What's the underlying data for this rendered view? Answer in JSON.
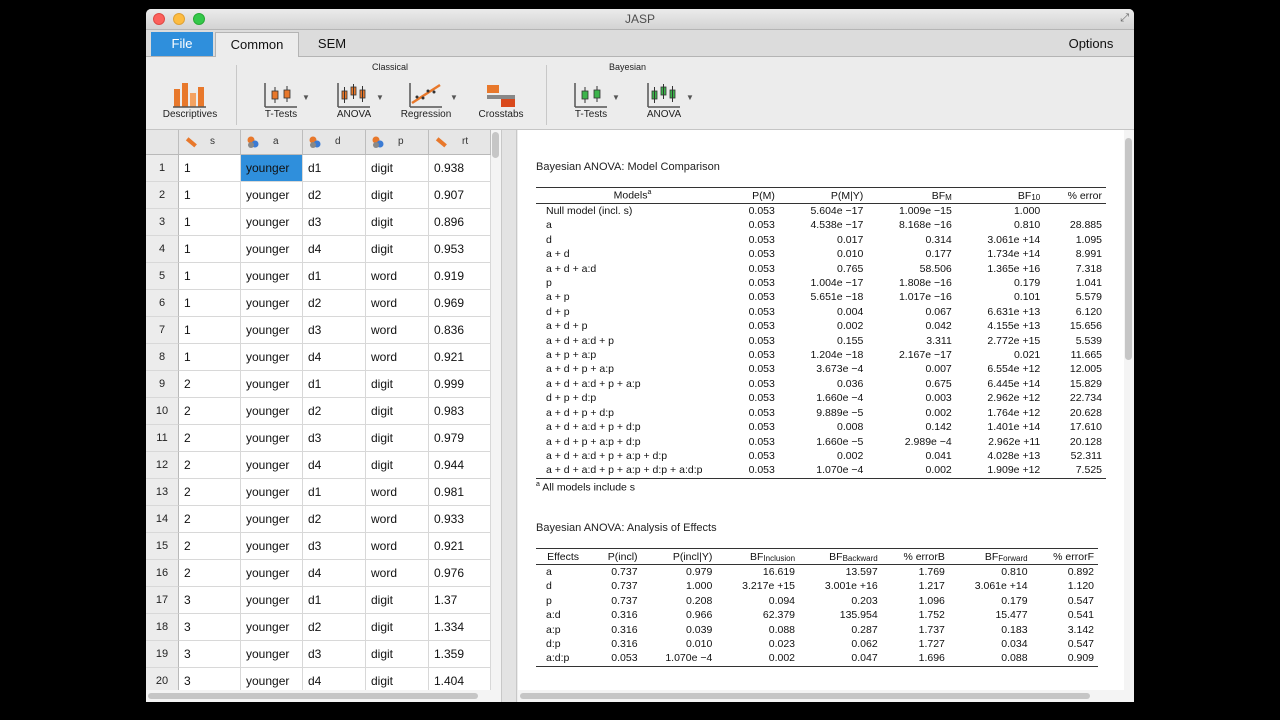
{
  "window": {
    "title": "JASP"
  },
  "tabs": {
    "file": "File",
    "common": "Common",
    "sem": "SEM",
    "options": "Options"
  },
  "ribbon": {
    "classical_label": "Classical",
    "bayesian_label": "Bayesian",
    "descriptives": "Descriptives",
    "t_tests": "T-Tests",
    "anova": "ANOVA",
    "regression": "Regression",
    "crosstabs": "Crosstabs",
    "b_t_tests": "T-Tests",
    "b_anova": "ANOVA"
  },
  "grid": {
    "columns": [
      "s",
      "a",
      "d",
      "p",
      "rt"
    ],
    "rows": [
      [
        "1",
        "younger",
        "d1",
        "digit",
        "0.938"
      ],
      [
        "1",
        "younger",
        "d2",
        "digit",
        "0.907"
      ],
      [
        "1",
        "younger",
        "d3",
        "digit",
        "0.896"
      ],
      [
        "1",
        "younger",
        "d4",
        "digit",
        "0.953"
      ],
      [
        "1",
        "younger",
        "d1",
        "word",
        "0.919"
      ],
      [
        "1",
        "younger",
        "d2",
        "word",
        "0.969"
      ],
      [
        "1",
        "younger",
        "d3",
        "word",
        "0.836"
      ],
      [
        "1",
        "younger",
        "d4",
        "word",
        "0.921"
      ],
      [
        "2",
        "younger",
        "d1",
        "digit",
        "0.999"
      ],
      [
        "2",
        "younger",
        "d2",
        "digit",
        "0.983"
      ],
      [
        "2",
        "younger",
        "d3",
        "digit",
        "0.979"
      ],
      [
        "2",
        "younger",
        "d4",
        "digit",
        "0.944"
      ],
      [
        "2",
        "younger",
        "d1",
        "word",
        "0.981"
      ],
      [
        "2",
        "younger",
        "d2",
        "word",
        "0.933"
      ],
      [
        "2",
        "younger",
        "d3",
        "word",
        "0.921"
      ],
      [
        "2",
        "younger",
        "d4",
        "word",
        "0.976"
      ],
      [
        "3",
        "younger",
        "d1",
        "digit",
        "1.37"
      ],
      [
        "3",
        "younger",
        "d2",
        "digit",
        "1.334"
      ],
      [
        "3",
        "younger",
        "d3",
        "digit",
        "1.359"
      ],
      [
        "3",
        "younger",
        "d4",
        "digit",
        "1.404"
      ]
    ]
  },
  "model_comparison": {
    "title": "Bayesian ANOVA: Model Comparison",
    "headers": [
      "Models",
      "P(M)",
      "P(M|Y)",
      "BF",
      "BF",
      "% error"
    ],
    "header_super": "a",
    "header_subs": [
      "M",
      "10"
    ],
    "rows": [
      [
        "Null model (incl. s)",
        "0.053",
        "5.604e −17",
        "1.009e −15",
        "1.000",
        ""
      ],
      [
        "a",
        "0.053",
        "4.538e −17",
        "8.168e −16",
        "0.810",
        "28.885"
      ],
      [
        "d",
        "0.053",
        "0.017",
        "0.314",
        "3.061e +14",
        "1.095"
      ],
      [
        "a + d",
        "0.053",
        "0.010",
        "0.177",
        "1.734e +14",
        "8.991"
      ],
      [
        "a + d + a:d",
        "0.053",
        "0.765",
        "58.506",
        "1.365e +16",
        "7.318"
      ],
      [
        "p",
        "0.053",
        "1.004e −17",
        "1.808e −16",
        "0.179",
        "1.041"
      ],
      [
        "a + p",
        "0.053",
        "5.651e −18",
        "1.017e −16",
        "0.101",
        "5.579"
      ],
      [
        "d + p",
        "0.053",
        "0.004",
        "0.067",
        "6.631e +13",
        "6.120"
      ],
      [
        "a + d + p",
        "0.053",
        "0.002",
        "0.042",
        "4.155e +13",
        "15.656"
      ],
      [
        "a + d + a:d + p",
        "0.053",
        "0.155",
        "3.311",
        "2.772e +15",
        "5.539"
      ],
      [
        "a + p + a:p",
        "0.053",
        "1.204e −18",
        "2.167e −17",
        "0.021",
        "11.665"
      ],
      [
        "a + d + p + a:p",
        "0.053",
        "3.673e −4",
        "0.007",
        "6.554e +12",
        "12.005"
      ],
      [
        "a + d + a:d + p + a:p",
        "0.053",
        "0.036",
        "0.675",
        "6.445e +14",
        "15.829"
      ],
      [
        "d + p + d:p",
        "0.053",
        "1.660e −4",
        "0.003",
        "2.962e +12",
        "22.734"
      ],
      [
        "a + d + p + d:p",
        "0.053",
        "9.889e −5",
        "0.002",
        "1.764e +12",
        "20.628"
      ],
      [
        "a + d + a:d + p + d:p",
        "0.053",
        "0.008",
        "0.142",
        "1.401e +14",
        "17.610"
      ],
      [
        "a + d + p + a:p + d:p",
        "0.053",
        "1.660e −5",
        "2.989e −4",
        "2.962e +11",
        "20.128"
      ],
      [
        "a + d + a:d + p + a:p + d:p",
        "0.053",
        "0.002",
        "0.041",
        "4.028e +13",
        "52.311"
      ],
      [
        "a + d + a:d + p + a:p + d:p + a:d:p",
        "0.053",
        "1.070e −4",
        "0.002",
        "1.909e +12",
        "7.525"
      ]
    ],
    "footnote_mark": "a",
    "footnote": "All models include s"
  },
  "effects": {
    "title": "Bayesian ANOVA: Analysis of Effects",
    "headers": [
      "Effects",
      "P(incl)",
      "P(incl|Y)",
      "BF",
      "BF",
      "% errorB",
      "BF",
      "% errorF"
    ],
    "header_subs": [
      "Inclusion",
      "Backward",
      "Forward"
    ],
    "rows": [
      [
        "a",
        "0.737",
        "0.979",
        "16.619",
        "13.597",
        "1.769",
        "0.810",
        "0.892"
      ],
      [
        "d",
        "0.737",
        "1.000",
        "3.217e +15",
        "3.001e +16",
        "1.217",
        "3.061e +14",
        "1.120"
      ],
      [
        "p",
        "0.737",
        "0.208",
        "0.094",
        "0.203",
        "1.096",
        "0.179",
        "0.547"
      ],
      [
        "a:d",
        "0.316",
        "0.966",
        "62.379",
        "135.954",
        "1.752",
        "15.477",
        "0.541"
      ],
      [
        "a:p",
        "0.316",
        "0.039",
        "0.088",
        "0.287",
        "1.737",
        "0.183",
        "3.142"
      ],
      [
        "d:p",
        "0.316",
        "0.010",
        "0.023",
        "0.062",
        "1.727",
        "0.034",
        "0.547"
      ],
      [
        "a:d:p",
        "0.053",
        "1.070e −4",
        "0.002",
        "0.047",
        "1.696",
        "0.088",
        "0.909"
      ]
    ]
  }
}
